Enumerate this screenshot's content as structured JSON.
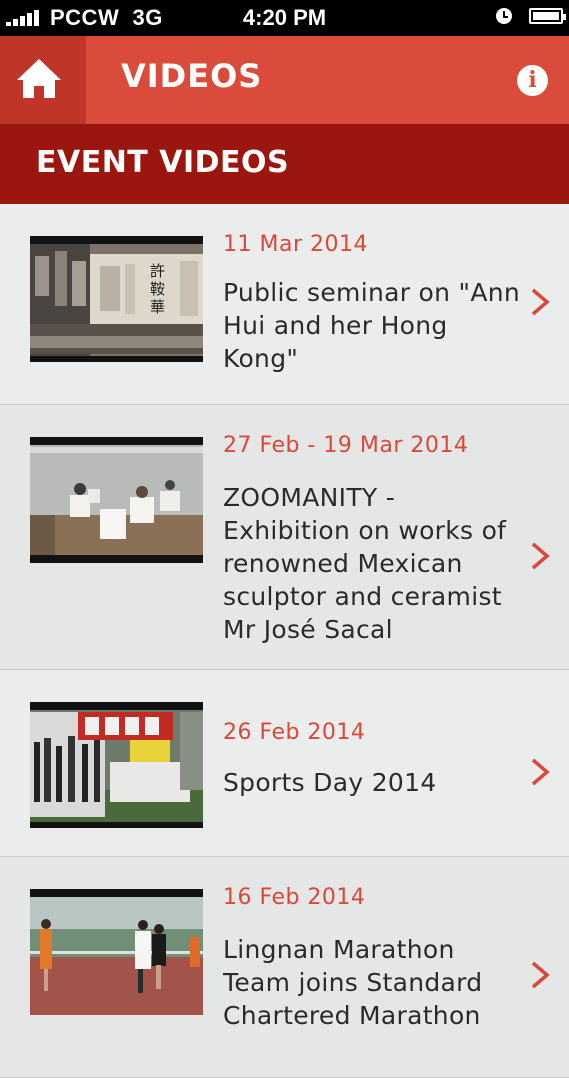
{
  "status_bar": {
    "carrier": "PCCW",
    "network": "3G",
    "time": "4:20 PM"
  },
  "header": {
    "title": "VIDEOS",
    "home_icon": "home-icon",
    "info_icon": "info-icon",
    "info_glyph": "i"
  },
  "section": {
    "title": "EVENT VIDEOS"
  },
  "videos": [
    {
      "date": "11 Mar 2014",
      "title": "Public seminar on \"Ann Hui and her Hong Kong\""
    },
    {
      "date": "27 Feb - 19 Mar 2014",
      "title": "ZOOMANITY - Exhibition on works of renowned Mexican sculptor and ceramist Mr José  Sacal"
    },
    {
      "date": "26 Feb 2014",
      "title": "Sports Day 2014"
    },
    {
      "date": "16 Feb 2014",
      "title": "Lingnan Marathon Team joins Standard Chartered Marathon"
    }
  ],
  "colors": {
    "header": "#da4b3c",
    "home_button": "#bf3628",
    "section_bar": "#9a160f",
    "accent_text": "#d9483a"
  }
}
